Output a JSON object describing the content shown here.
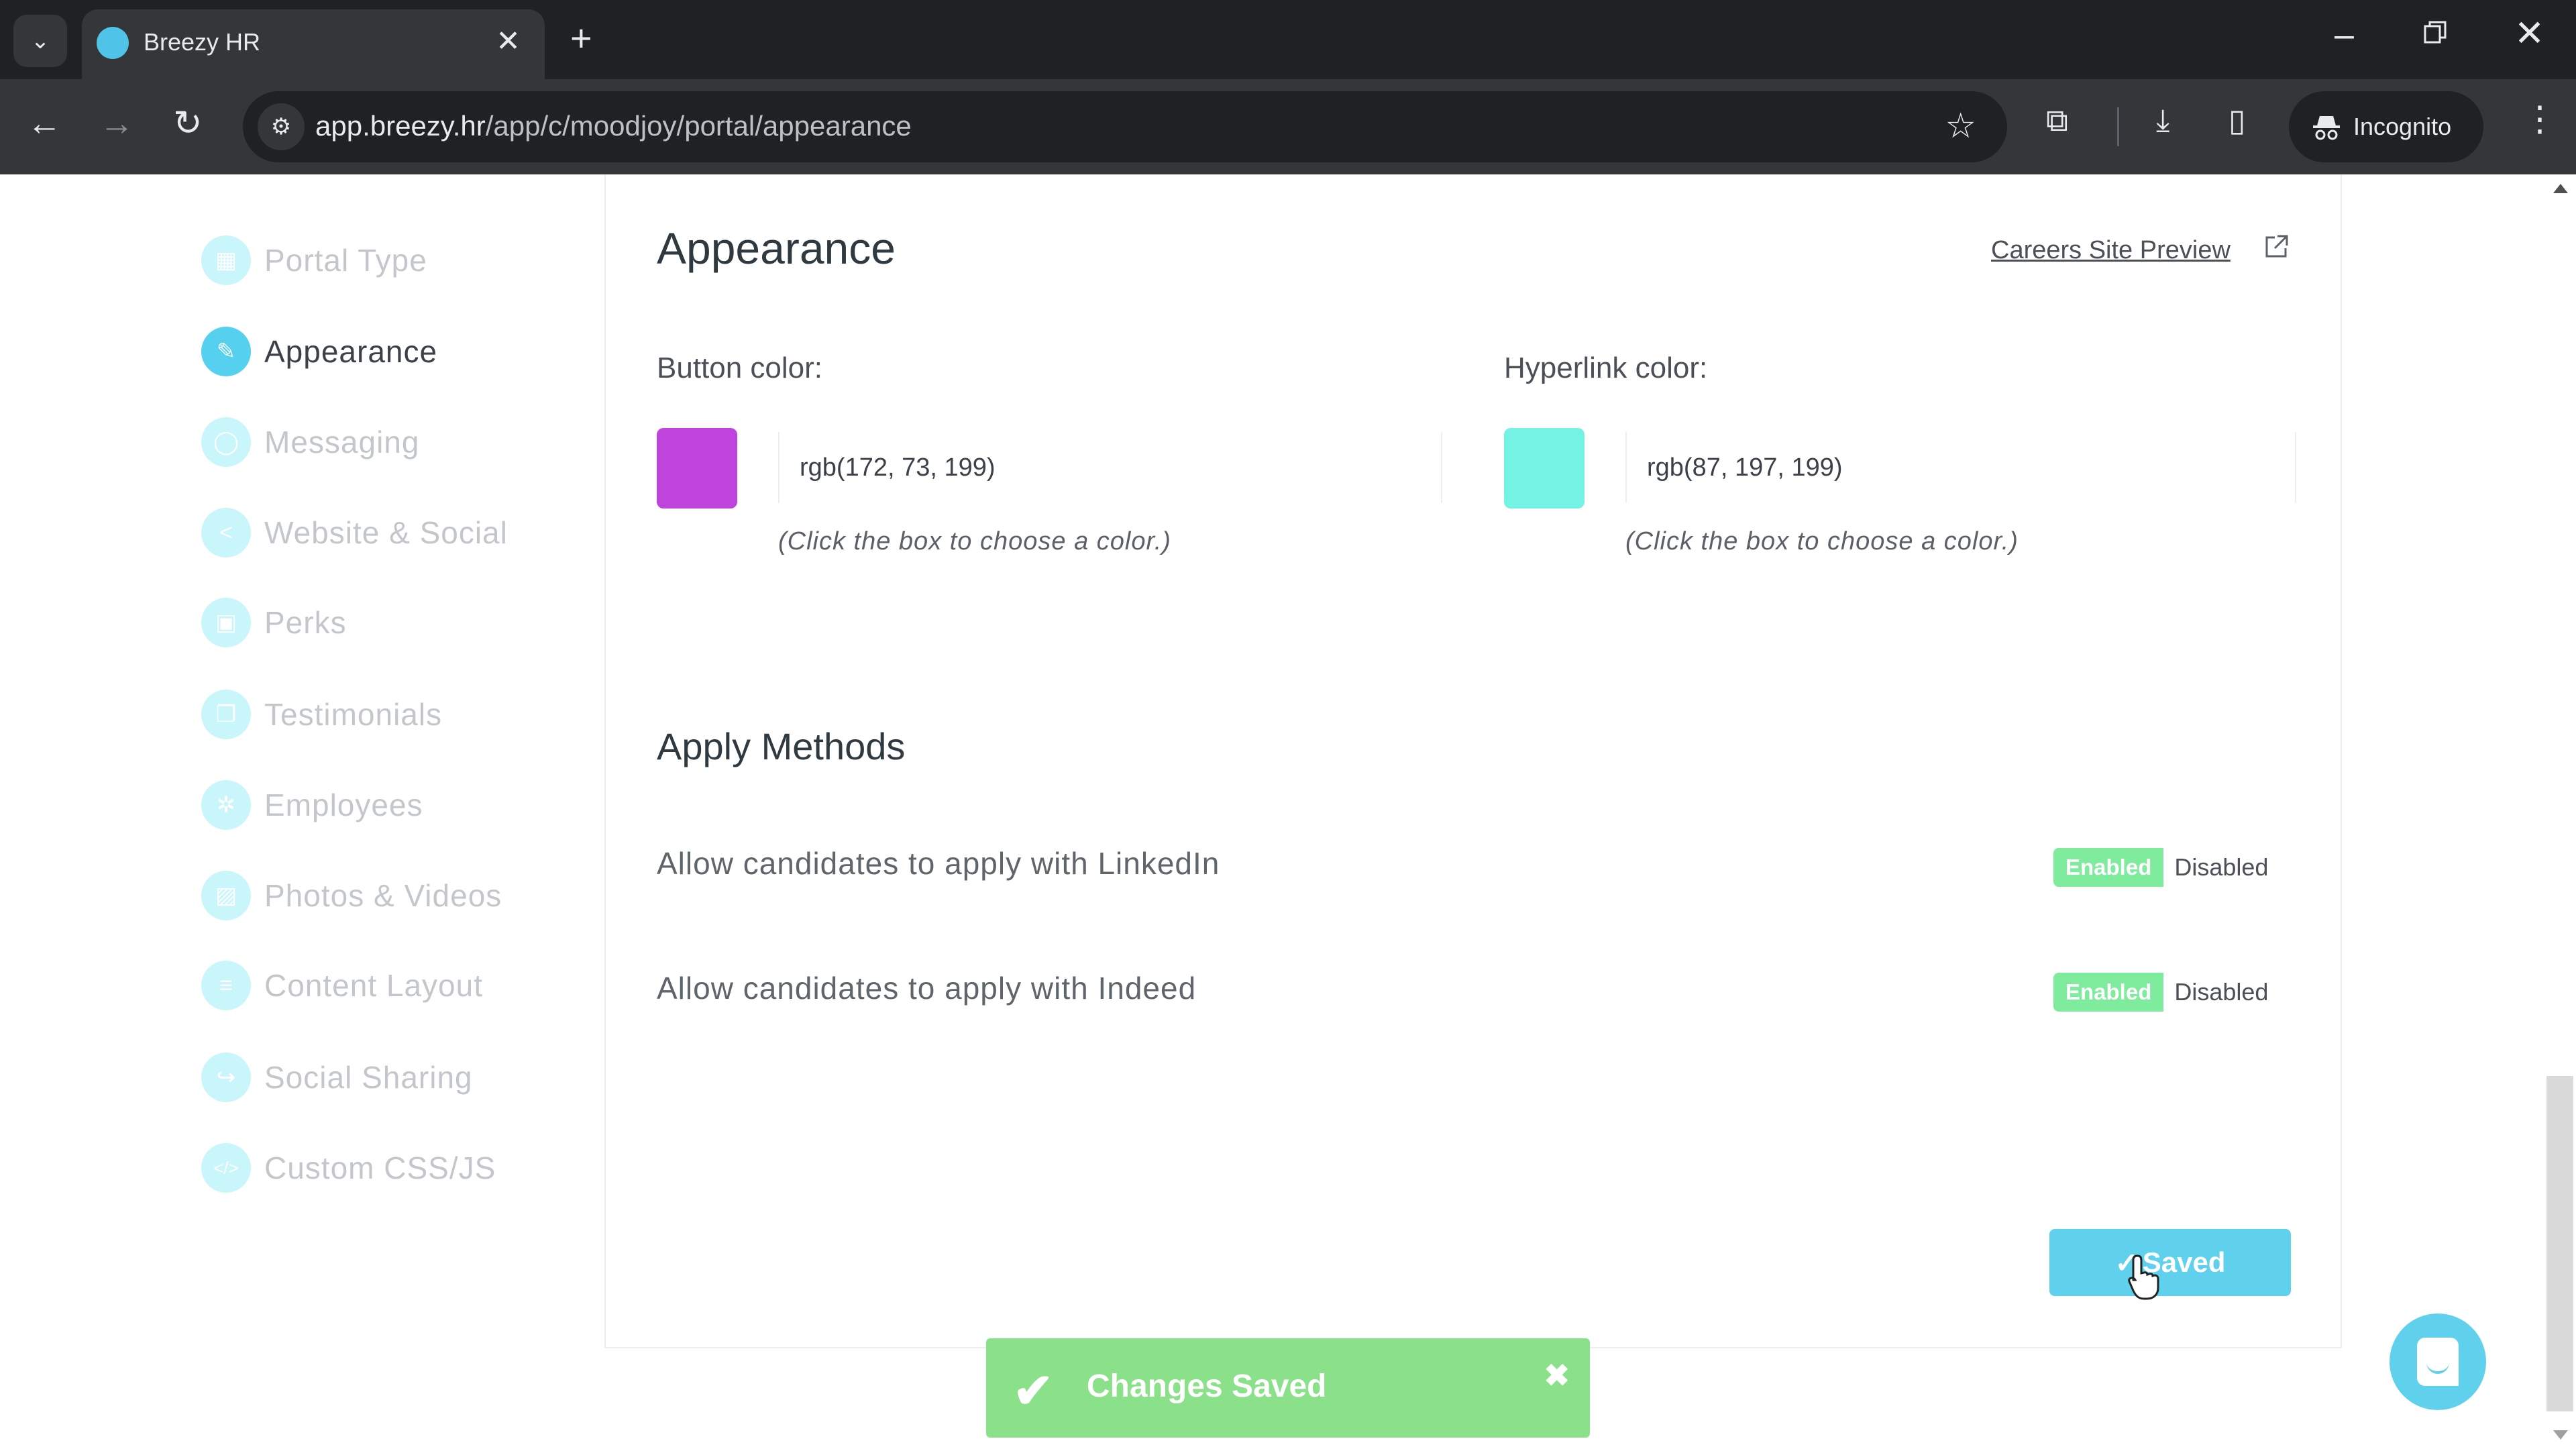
{
  "browser": {
    "tab_title": "Breezy HR",
    "url_host": "app.breezy.hr",
    "url_path": "/app/c/moodjoy/portal/appearance",
    "profile_label": "Incognito",
    "icons": {
      "tab_search": "chevron-down-icon",
      "tab_close": "close-icon",
      "new_tab": "plus-icon",
      "back": "arrow-left-icon",
      "forward": "arrow-right-icon",
      "reload": "reload-icon",
      "site_info": "tune-icon",
      "bookmark": "star-icon",
      "extensions": "puzzle-icon",
      "downloads": "download-icon",
      "side_panel": "side-panel-icon",
      "incognito": "incognito-icon",
      "menu": "more-vert-icon"
    },
    "glyphs": {
      "tab_search": "⌄",
      "tab_close": "✕",
      "new_tab": "+",
      "back": "←",
      "forward": "→",
      "reload": "↻",
      "site_info": "⚙",
      "bookmark": "☆",
      "extensions": "⧉",
      "downloads": "⤓",
      "side_panel": "▯",
      "incognito": "🕵",
      "menu": "⋮",
      "minimize": "–",
      "close": "✕"
    }
  },
  "sidebar": {
    "items": [
      {
        "label": "Portal Type",
        "icon": "table-icon",
        "glyph": "▦",
        "active": false
      },
      {
        "label": "Appearance",
        "icon": "paintbrush-icon",
        "glyph": "✎",
        "active": true
      },
      {
        "label": "Messaging",
        "icon": "chat-icon",
        "glyph": "◯",
        "active": false
      },
      {
        "label": "Website & Social",
        "icon": "share-icon",
        "glyph": "<",
        "active": false
      },
      {
        "label": "Perks",
        "icon": "gift-icon",
        "glyph": "▣",
        "active": false
      },
      {
        "label": "Testimonials",
        "icon": "comments-icon",
        "glyph": "❐",
        "active": false
      },
      {
        "label": "Employees",
        "icon": "users-icon",
        "glyph": "✲",
        "active": false
      },
      {
        "label": "Photos & Videos",
        "icon": "image-icon",
        "glyph": "▨",
        "active": false
      },
      {
        "label": "Content Layout",
        "icon": "list-icon",
        "glyph": "≡",
        "active": false
      },
      {
        "label": "Social Sharing",
        "icon": "share-arrow-icon",
        "glyph": "↪",
        "active": false
      },
      {
        "label": "Custom CSS/JS",
        "icon": "code-icon",
        "glyph": "</>",
        "active": false
      }
    ]
  },
  "appearance": {
    "title": "Appearance",
    "preview_link": "Careers Site Preview",
    "button_color": {
      "label": "Button color:",
      "value": "rgb(172, 73, 199)",
      "swatch": "#bf44de",
      "hint": "(Click the box to choose a color.)"
    },
    "hyperlink_color": {
      "label": "Hyperlink color:",
      "value": "rgb(87, 197, 199)",
      "swatch": "#74f2e4",
      "hint": "(Click the box to choose a color.)"
    }
  },
  "apply_methods": {
    "title": "Apply Methods",
    "rows": [
      {
        "label": "Allow candidates to apply with LinkedIn",
        "on_label": "Enabled",
        "off_label": "Disabled",
        "state": "Enabled"
      },
      {
        "label": "Allow candidates to apply with Indeed",
        "on_label": "Enabled",
        "off_label": "Disabled",
        "state": "Enabled"
      }
    ]
  },
  "save_button": {
    "label": "Saved",
    "icon": "check-icon",
    "glyph": "✓"
  },
  "toast": {
    "message": "Changes Saved",
    "icon": "check-icon",
    "glyph": "✔",
    "close_glyph": "✖"
  },
  "colors": {
    "accent": "#5fd1ec",
    "success": "#8be08a",
    "toggle_on": "#7eeb9d"
  }
}
